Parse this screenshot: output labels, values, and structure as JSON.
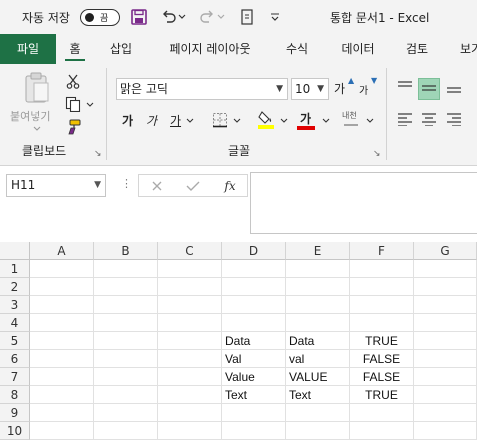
{
  "titlebar": {
    "autosave_label": "자동 저장",
    "autosave_toggle": "끔",
    "title": "통합 문서1  -  Excel"
  },
  "tabs": [
    {
      "label": "파일"
    },
    {
      "label": "홈"
    },
    {
      "label": "삽입"
    },
    {
      "label": "페이지 레이아웃"
    },
    {
      "label": "수식"
    },
    {
      "label": "데이터"
    },
    {
      "label": "검토"
    },
    {
      "label": "보기"
    }
  ],
  "ribbon": {
    "clipboard": {
      "paste_label": "붙여넣기",
      "group_label": "클립보드"
    },
    "font": {
      "font_name": "맑은 고딕",
      "font_size": "10",
      "bold": "가",
      "italic": "가",
      "underline": "가",
      "increase_size": "가",
      "decrease_size": "가",
      "font_color": "가",
      "phonetic": "내천",
      "group_label": "글꼴"
    }
  },
  "formula_bar": {
    "name_box": "H11",
    "fx_label": "fx",
    "formula": ""
  },
  "grid": {
    "columns": [
      "A",
      "B",
      "C",
      "D",
      "E",
      "F",
      "G"
    ],
    "rows": [
      "1",
      "2",
      "3",
      "4",
      "5",
      "6",
      "7",
      "8",
      "9",
      "10"
    ],
    "cells": {
      "D5": "Data",
      "E5": "Data",
      "F5": "TRUE",
      "D6": "Val",
      "E6": "val",
      "F6": "FALSE",
      "D7": "Value",
      "E7": "VALUE",
      "F7": "FALSE",
      "D8": "Text",
      "E8": "Text",
      "F8": "TRUE"
    }
  },
  "colors": {
    "accent": "#1e7145",
    "selected_align": "#9fd5b7",
    "highlight_yellow": "#ffff00",
    "font_red": "#e00000"
  }
}
